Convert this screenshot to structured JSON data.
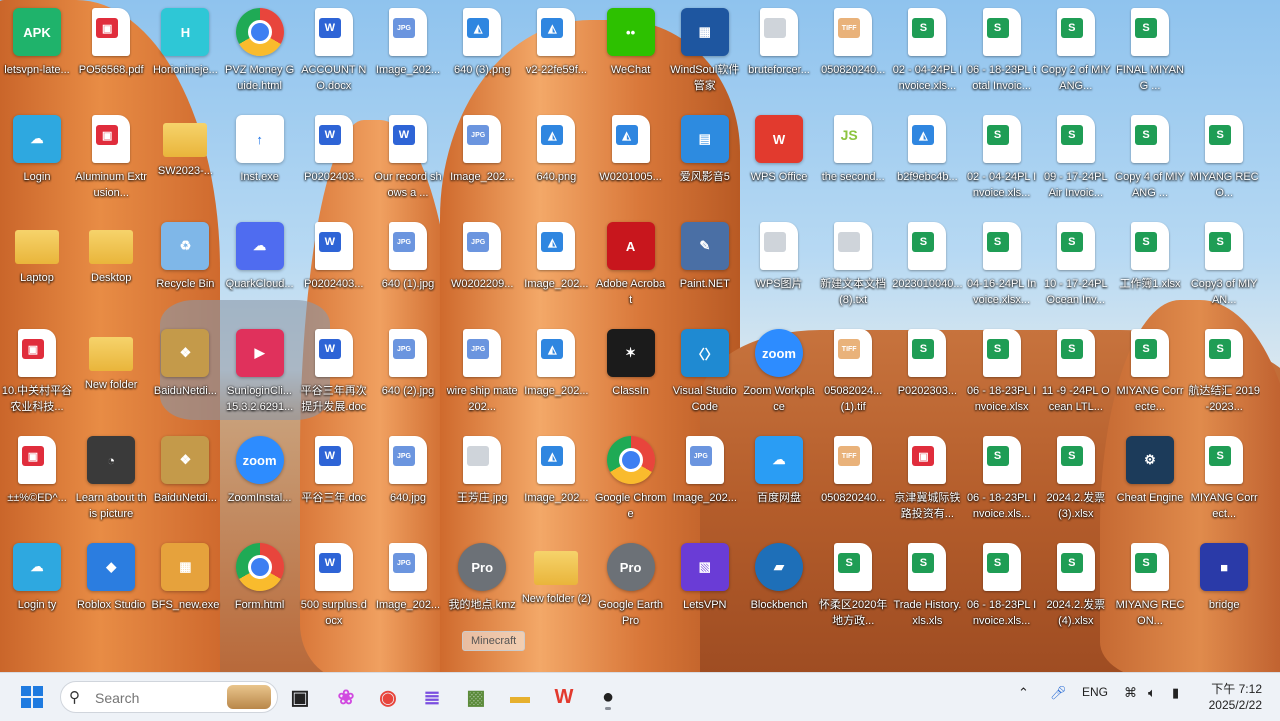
{
  "desktop": {
    "icons": [
      {
        "label": "letsvpn-late...",
        "type": "app",
        "glyph": "APK",
        "color": "#1fb36b"
      },
      {
        "label": "PO56568.pdf",
        "type": "pdf"
      },
      {
        "label": "Horionineje...",
        "type": "app",
        "glyph": "H",
        "color": "#2ec7d6"
      },
      {
        "label": "PVZ Money Guide.html",
        "type": "chrome"
      },
      {
        "label": "ACCOUNT NO.docx",
        "type": "word"
      },
      {
        "label": "Image_202...",
        "type": "jpg"
      },
      {
        "label": "640 (3).png",
        "type": "img"
      },
      {
        "label": "v2-22fe59f...",
        "type": "img"
      },
      {
        "label": "WeChat",
        "type": "app",
        "glyph": "••",
        "color": "#2dc100"
      },
      {
        "label": "WindSoul软件管家",
        "type": "app",
        "glyph": "▦",
        "color": "#1e56a0"
      },
      {
        "label": "bruteforcer...",
        "type": "txt"
      },
      {
        "label": "050820240...",
        "type": "tiff"
      },
      {
        "label": "02 - 04-24PL Invoice.xls...",
        "type": "excel"
      },
      {
        "label": "06 - 18-23PL total Invoic...",
        "type": "excel"
      },
      {
        "label": "Copy 2 of MIYANG...",
        "type": "excel"
      },
      {
        "label": "FINAL MIYANG ...",
        "type": "excel"
      },
      {
        "label": "Login",
        "type": "app",
        "glyph": "☁",
        "color": "#2ea8e0"
      },
      {
        "label": "Aluminum Extrusion...",
        "type": "pdf"
      },
      {
        "label": "SW2023-...",
        "type": "folder"
      },
      {
        "label": "Inst.exe",
        "type": "app",
        "glyph": "↑",
        "color": "#ffffff"
      },
      {
        "label": "P0202403...",
        "type": "word"
      },
      {
        "label": "Our record shows a ...",
        "type": "word"
      },
      {
        "label": "Image_202...",
        "type": "jpg"
      },
      {
        "label": "640.png",
        "type": "img"
      },
      {
        "label": "W0201005...",
        "type": "img"
      },
      {
        "label": "爱风影音5",
        "type": "app",
        "glyph": "▤",
        "color": "#2d8be0"
      },
      {
        "label": "WPS Office",
        "type": "app",
        "glyph": "W",
        "color": "#e23a2e"
      },
      {
        "label": "the second...",
        "type": "js"
      },
      {
        "label": "b2f9ebc4b...",
        "type": "img"
      },
      {
        "label": "02 - 04-24PL Invoice.xls...",
        "type": "excel"
      },
      {
        "label": "09 - 17-24PL Air Invoic...",
        "type": "excel"
      },
      {
        "label": "Copy 4 of MIYANG ...",
        "type": "excel"
      },
      {
        "label": "MIYANG RECO...",
        "type": "excel"
      },
      {
        "label": "Laptop",
        "type": "folder"
      },
      {
        "label": "Desktop",
        "type": "folder"
      },
      {
        "label": "Recycle Bin",
        "type": "app",
        "glyph": "♻",
        "color": "#7fb7e8"
      },
      {
        "label": "QuarkCloud...",
        "type": "app",
        "glyph": "☁",
        "color": "#4f6cf0"
      },
      {
        "label": "P0202403...",
        "type": "word"
      },
      {
        "label": "640 (1).jpg",
        "type": "jpg"
      },
      {
        "label": "W0202209...",
        "type": "jpg"
      },
      {
        "label": "Image_202...",
        "type": "img"
      },
      {
        "label": "Adobe Acrobat",
        "type": "app",
        "glyph": "A",
        "color": "#c8161d"
      },
      {
        "label": "Paint.NET",
        "type": "app",
        "glyph": "✎",
        "color": "#4a6fa5"
      },
      {
        "label": "WPS图片",
        "type": "txt"
      },
      {
        "label": "新建文本文档 (8).txt",
        "type": "txt"
      },
      {
        "label": "2023010040...",
        "type": "excel"
      },
      {
        "label": "04-16-24PL Invoice.xlsx...",
        "type": "excel"
      },
      {
        "label": "10 - 17-24PL Ocean Inv...",
        "type": "excel"
      },
      {
        "label": "工作簿1.xlsx",
        "type": "excel"
      },
      {
        "label": "Copy3 of MIYAN...",
        "type": "excel"
      },
      {
        "label": "10.中关村平谷农业科技...",
        "type": "pdf"
      },
      {
        "label": "New folder",
        "type": "folder"
      },
      {
        "label": "BaiduNetdi...",
        "type": "app",
        "glyph": "❖",
        "color": "#c49a4a"
      },
      {
        "label": "SunloginCli... 15.3.2.6291...",
        "type": "app",
        "glyph": "▶",
        "color": "#e0315c"
      },
      {
        "label": "平谷三年再次提升发展.doc",
        "type": "word"
      },
      {
        "label": "640 (2).jpg",
        "type": "jpg"
      },
      {
        "label": "wire ship mate 202...",
        "type": "jpg"
      },
      {
        "label": "Image_202...",
        "type": "img"
      },
      {
        "label": "ClassIn",
        "type": "app",
        "glyph": "✶",
        "color": "#1b1b1b"
      },
      {
        "label": "Visual Studio Code",
        "type": "app",
        "glyph": "〈〉",
        "color": "#1f8ad2"
      },
      {
        "label": "Zoom Workplace",
        "type": "app",
        "glyph": "zoom",
        "color": "#2d8cff",
        "round": true
      },
      {
        "label": "05082024... (1).tif",
        "type": "tiff"
      },
      {
        "label": "P0202303...",
        "type": "excel"
      },
      {
        "label": "06 - 18-23PL Invoice.xlsx",
        "type": "excel"
      },
      {
        "label": "11 -9 -24PL Ocean LTL...",
        "type": "excel"
      },
      {
        "label": "MIYANG Correcte...",
        "type": "excel"
      },
      {
        "label": "航达结汇 2019-2023...",
        "type": "excel"
      },
      {
        "label": "±±%©ED^...",
        "type": "pdf"
      },
      {
        "label": "Learn about this picture",
        "type": "app",
        "glyph": "◔",
        "color": "#3a3a3a"
      },
      {
        "label": "BaiduNetdi...",
        "type": "app",
        "glyph": "❖",
        "color": "#c49a4a"
      },
      {
        "label": "ZoomInstal...",
        "type": "app",
        "glyph": "zoom",
        "color": "#2d8cff",
        "round": true
      },
      {
        "label": "平谷三年.doc",
        "type": "word"
      },
      {
        "label": "640.jpg",
        "type": "jpg"
      },
      {
        "label": "王芳庄.jpg",
        "type": "txt"
      },
      {
        "label": "Image_202...",
        "type": "img"
      },
      {
        "label": "Google Chrome",
        "type": "chrome"
      },
      {
        "label": "Image_202...",
        "type": "jpg"
      },
      {
        "label": "百度网盘",
        "type": "app",
        "glyph": "☁",
        "color": "#2a9df4"
      },
      {
        "label": "050820240...",
        "type": "tiff"
      },
      {
        "label": "京津冀城际铁路投资有...",
        "type": "pdf"
      },
      {
        "label": "06 - 18-23PL Invoice.xls...",
        "type": "excel"
      },
      {
        "label": "2024.2.发票 (3).xlsx",
        "type": "excel"
      },
      {
        "label": "Cheat Engine",
        "type": "app",
        "glyph": "⚙",
        "color": "#1c3b5a"
      },
      {
        "label": "MIYANG Correct...",
        "type": "excel"
      },
      {
        "label": "Login ty",
        "type": "app",
        "glyph": "☁",
        "color": "#2ea8e0"
      },
      {
        "label": "Roblox Studio",
        "type": "app",
        "glyph": "◆",
        "color": "#2b7de0"
      },
      {
        "label": "BFS_new.exe",
        "type": "app",
        "glyph": "▦",
        "color": "#e6a23c"
      },
      {
        "label": "Form.html",
        "type": "chrome"
      },
      {
        "label": "500 surplus.docx",
        "type": "word"
      },
      {
        "label": "Image_202...",
        "type": "jpg"
      },
      {
        "label": "我的地点.kmz",
        "type": "app",
        "glyph": "Pro",
        "color": "#6c7177",
        "round": true
      },
      {
        "label": "New folder (2)",
        "type": "folder"
      },
      {
        "label": "Google Earth Pro",
        "type": "app",
        "glyph": "Pro",
        "color": "#6c7177",
        "round": true
      },
      {
        "label": "LetsVPN",
        "type": "app",
        "glyph": "▧",
        "color": "#6a3cd6"
      },
      {
        "label": "Blockbench",
        "type": "app",
        "glyph": "▰",
        "color": "#1e6fb8",
        "round": true
      },
      {
        "label": "怀柔区2020年地方政...",
        "type": "excel"
      },
      {
        "label": "Trade History.xls.xls",
        "type": "excel"
      },
      {
        "label": "06 - 18-23PL Invoice.xls...",
        "type": "excel"
      },
      {
        "label": "2024.2.发票 (4).xlsx",
        "type": "excel"
      },
      {
        "label": "MIYANG RECON...",
        "type": "excel"
      },
      {
        "label": "bridge",
        "type": "app",
        "glyph": "■",
        "color": "#2a3aa8"
      }
    ],
    "tooltip": "Minecraft"
  },
  "taskbar": {
    "search_placeholder": "Search",
    "language": "ENG",
    "time": "下午 7:12",
    "date": "2025/2/22",
    "pinned": [
      {
        "name": "task-view",
        "glyph": "▣",
        "color": "#222"
      },
      {
        "name": "copilot",
        "glyph": "❀",
        "color": "#d14ae0"
      },
      {
        "name": "chrome",
        "glyph": "◉",
        "color": "#e8453c"
      },
      {
        "name": "purple-app",
        "glyph": "≣",
        "color": "#7a4ee0"
      },
      {
        "name": "minecraft",
        "glyph": "▩",
        "color": "#5b8b3a"
      },
      {
        "name": "file-explorer",
        "glyph": "▬",
        "color": "#e6b02e"
      },
      {
        "name": "wps-office",
        "glyph": "W",
        "color": "#e23a2e"
      },
      {
        "name": "obs",
        "glyph": "●",
        "color": "#222"
      }
    ]
  }
}
